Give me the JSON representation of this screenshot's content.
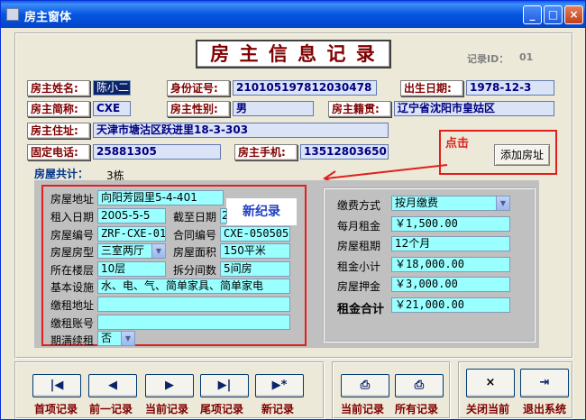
{
  "window": {
    "title": "房主窗体"
  },
  "header": {
    "title": "房 主 信 息 记 录",
    "record_id_label": "记录ID：",
    "record_id_value": "01"
  },
  "owner": {
    "name_label": "房主姓名:",
    "name_value": "陈小二",
    "id_label": "身份证号:",
    "id_value": "210105197812030478",
    "birth_label": "出生日期:",
    "birth_value": "1978-12-3",
    "short_label": "房主简称:",
    "short_value": "CXE",
    "gender_label": "房主性别:",
    "gender_value": "男",
    "origin_label": "房主籍贯:",
    "origin_value": "辽宁省沈阳市皇姑区",
    "address_label": "房主住址:",
    "address_value": "天津市塘沽区跃进里18-3-303",
    "phone_label": "固定电话:",
    "phone_value": "25881305",
    "mobile_label": "房主手机:",
    "mobile_value": "13512803650",
    "houses_label": "房屋共计：",
    "houses_value": "3栋"
  },
  "actions": {
    "click_hint": "点击",
    "add_house_label": "添加房址"
  },
  "house": {
    "new_record_note": "新纪录",
    "address_label": "房屋地址",
    "address_value": "向阳芳园里5-4-401",
    "rent_date_label": "租入日期",
    "rent_date_value": "2005-5-5",
    "end_date_label": "截至日期",
    "end_date_value": "2",
    "house_no_label": "房屋编号",
    "house_no_value": "ZRF-CXE-01",
    "contract_no_label": "合同编号",
    "contract_no_value": "CXE-05050501",
    "type_label": "房屋房型",
    "type_value": "三室两厅",
    "area_label": "房屋面积",
    "area_value": "150平米",
    "floor_label": "所在楼层",
    "floor_value": "10层",
    "split_label": "拆分间数",
    "split_value": "5间房",
    "facility_label": "基本设施",
    "facility_value": "水、电、气、简单家具、简单家电",
    "pay_addr_label": "缴租地址",
    "pay_addr_value": "",
    "pay_acct_label": "缴租账号",
    "pay_acct_value": "",
    "renew_label": "期满续租",
    "renew_value": "否"
  },
  "payment": {
    "method_label": "缴费方式",
    "method_value": "按月缴费",
    "monthly_label": "每月租金",
    "monthly_value": "￥1,500.00",
    "period_label": "房屋租期",
    "period_value": "12个月",
    "subtotal_label": "租金小计",
    "subtotal_value": "￥18,000.00",
    "deposit_label": "房屋押金",
    "deposit_value": "￥3,000.00",
    "total_label": "租金合计",
    "total_value": "￥21,000.00"
  },
  "nav": {
    "first_label": "首项记录",
    "prev_label": "前一记录",
    "current_label": "当前记录",
    "last_label": "尾项记录",
    "new_label": "新记录",
    "print_current_label": "当前记录",
    "print_all_label": "所有记录",
    "close_label": "关闭当前",
    "exit_label": "退出系统"
  },
  "colors": {
    "highlight_red": "#e0201c",
    "label_maroon": "#800000",
    "field_cyan": "#99ffff"
  }
}
